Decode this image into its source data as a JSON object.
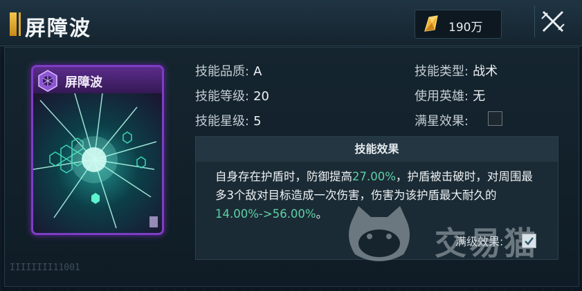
{
  "header": {
    "title": "屏障波",
    "currency_value": "190万"
  },
  "card": {
    "title": "屏障波"
  },
  "stats": {
    "quality_label": "技能品质:",
    "quality_value": "A",
    "level_label": "技能等级:",
    "level_value": "20",
    "star_label": "技能星级:",
    "star_value": "5",
    "type_label": "技能类型:",
    "type_value": "战术",
    "hero_label": "使用英雄:",
    "hero_value": "无",
    "maxstar_label": "满星效果:",
    "maxstar_checked": false
  },
  "effect": {
    "heading": "技能效果",
    "text_part1": "自身存在护盾时，防御提高",
    "highlight1": "27.00%",
    "text_part2": "，护盾被击破时，对周围最多3个敌对目标造成一次伤害，伤害为该护盾最大耐久的",
    "highlight2": "14.00%->56.00%",
    "text_part3": "。",
    "max_level_label": "满级效果:",
    "max_level_checked": true
  },
  "watermark": {
    "text": "交易猫"
  },
  "footer": {
    "id_text": "IIIIIIII11001"
  },
  "colors": {
    "highlight": "#5ed1a7",
    "card_border": "#7c3fc4",
    "title_accent": "#f4c44a"
  },
  "icons": {
    "currency": "gold-crystal-icon",
    "close": "close-icon",
    "card_emblem": "hexagon-emblem-icon",
    "check": "checkmark-icon"
  }
}
